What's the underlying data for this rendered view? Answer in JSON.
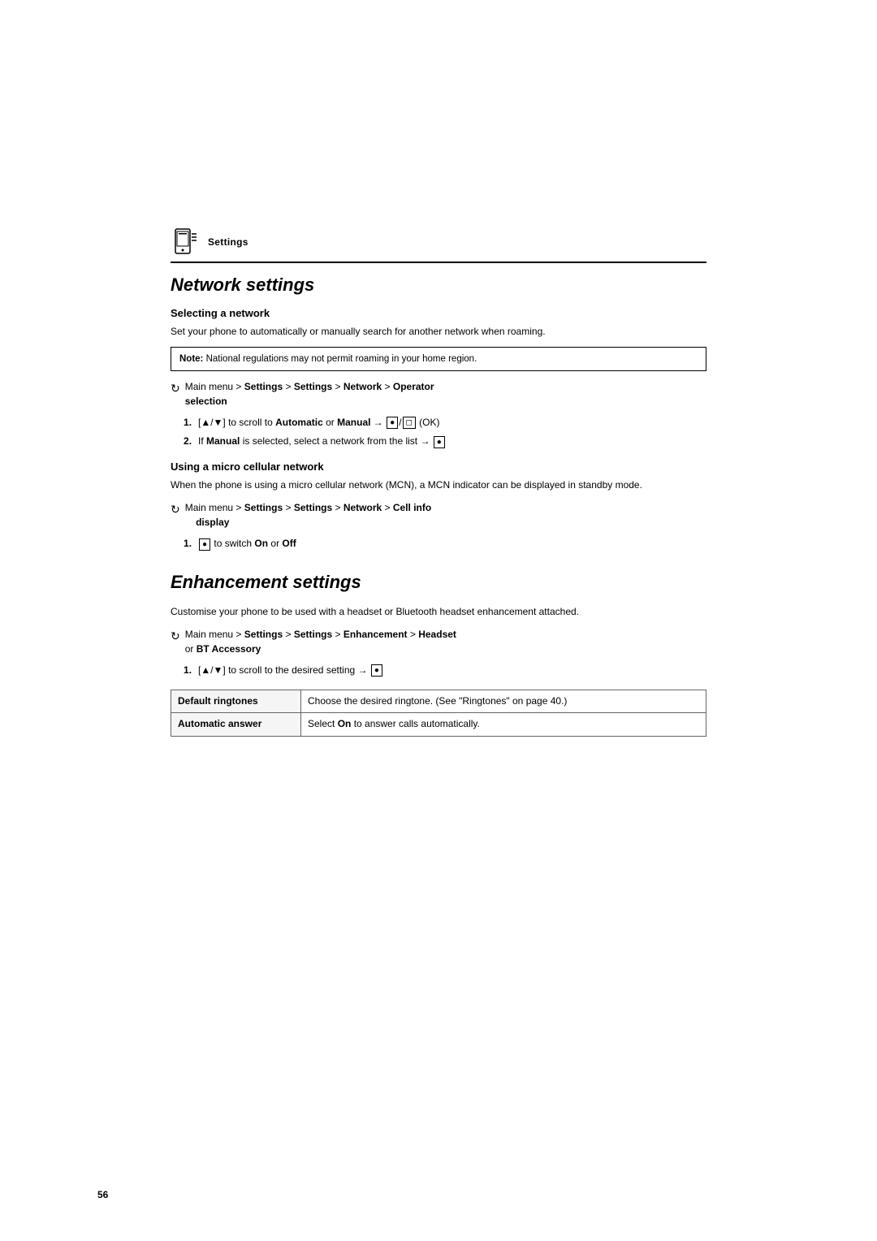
{
  "page": {
    "number": "56"
  },
  "settings_header": {
    "label": "Settings"
  },
  "network_settings": {
    "title": "Network settings",
    "selecting_network": {
      "subtitle": "Selecting a network",
      "description": "Set your phone to automatically or manually search for another network when roaming.",
      "note": {
        "label": "Note:",
        "text": "National regulations may not permit roaming in your home region."
      },
      "menu_path": "Main menu > Settings > Settings > Network > Operator selection",
      "steps": [
        {
          "number": "1",
          "text": "[▲/▼] to scroll to Automatic or Manual → [●]/[◻] (OK)"
        },
        {
          "number": "2",
          "text": "If Manual is selected, select a network from the list → [●]"
        }
      ]
    },
    "micro_cellular": {
      "subtitle": "Using a micro cellular network",
      "description": "When the phone is using a micro cellular network (MCN), a MCN indicator can be displayed in standby mode.",
      "menu_path": "Main menu > Settings > Settings > Network > Cell info display",
      "steps": [
        {
          "number": "1",
          "text": "[●] to switch On or Off"
        }
      ]
    }
  },
  "enhancement_settings": {
    "title": "Enhancement settings",
    "description": "Customise your phone to be used with a headset or Bluetooth headset enhancement attached.",
    "menu_path": "Main menu > Settings > Settings > Enhancement > Headset or BT Accessory",
    "steps": [
      {
        "number": "1",
        "text": "[▲/▼] to scroll to the desired setting → [●]"
      }
    ],
    "table": {
      "rows": [
        {
          "label": "Default ringtones",
          "value": "Choose the desired ringtone. (See \"Ringtones\" on page 40.)"
        },
        {
          "label": "Automatic answer",
          "value": "Select On to answer calls automatically."
        }
      ]
    }
  }
}
